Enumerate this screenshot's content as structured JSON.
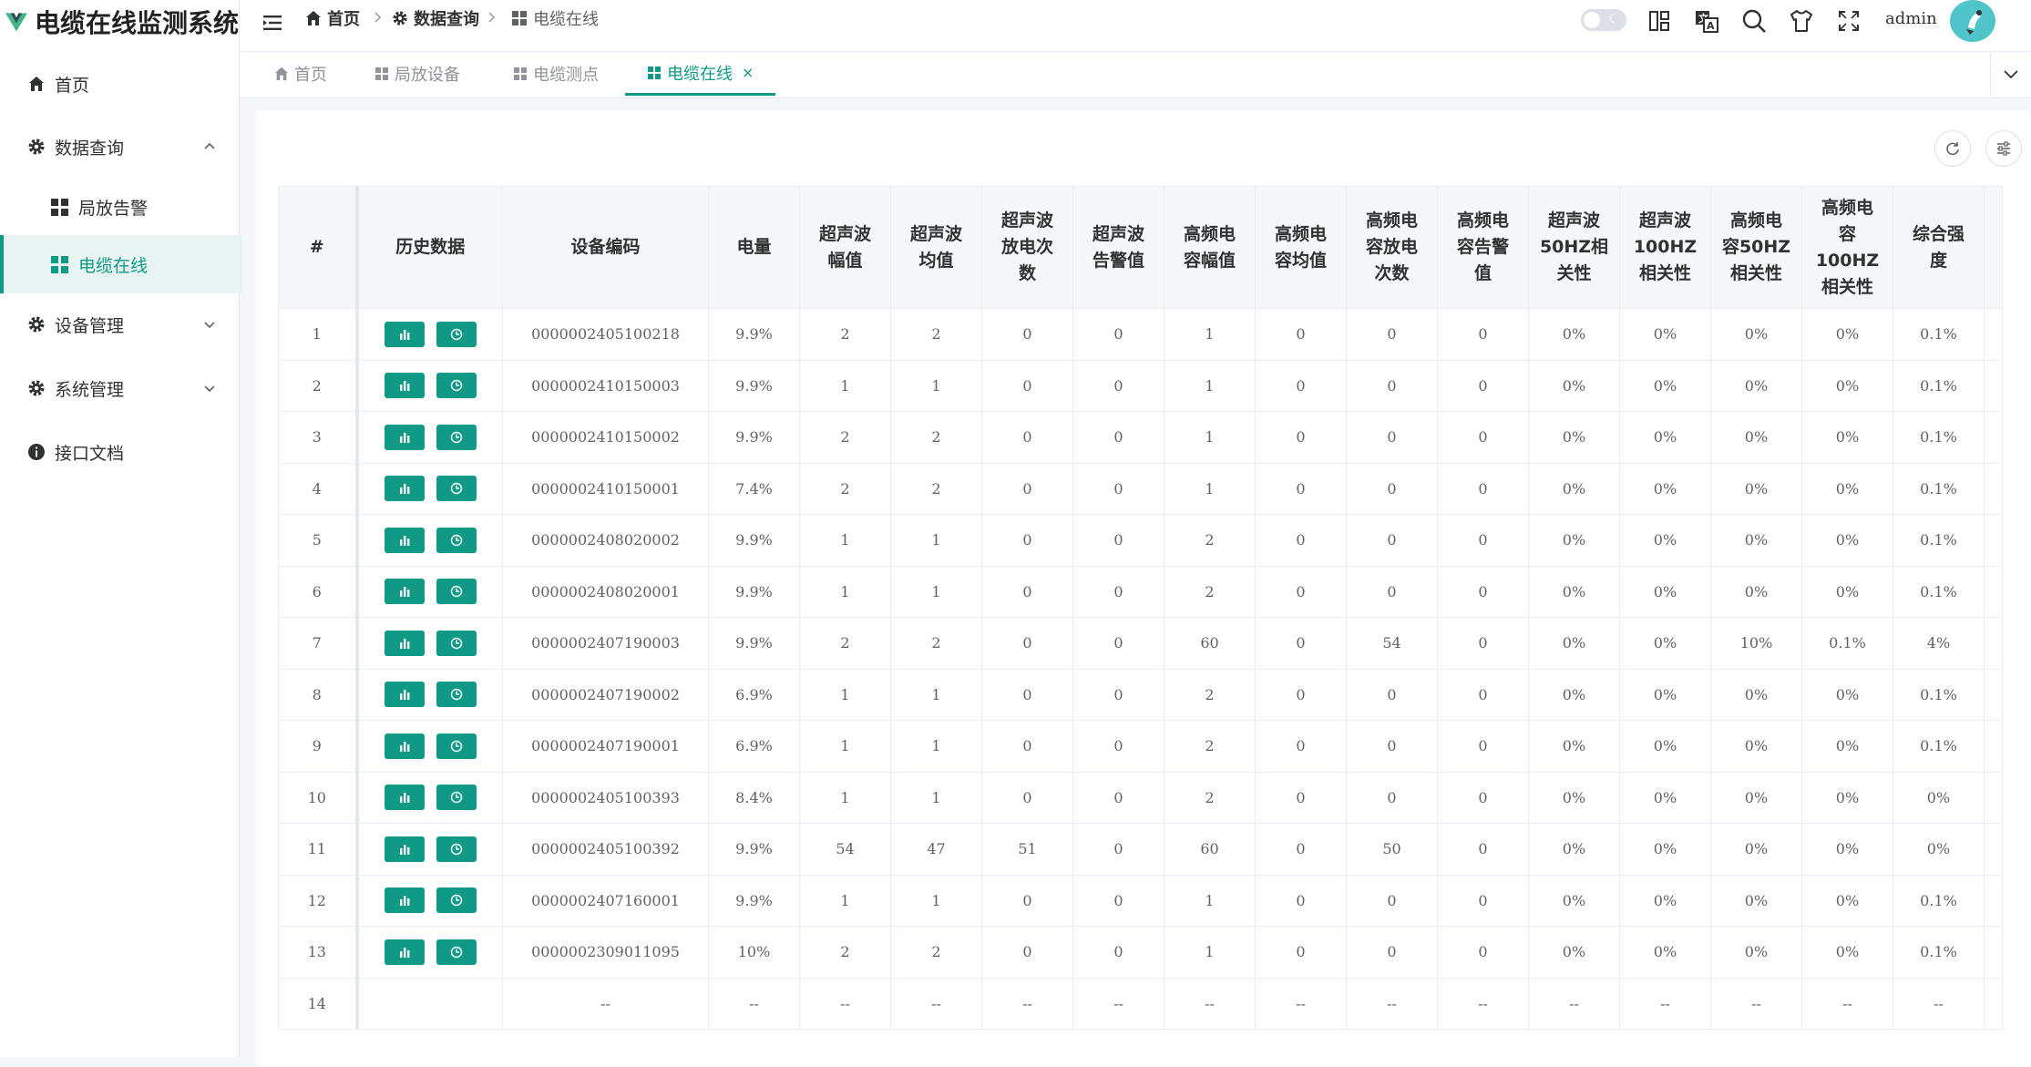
{
  "app": {
    "title": "电缆在线监测系统",
    "logo_icon": "vue-logo-icon",
    "accent": "#0f9a85"
  },
  "sidebar": {
    "items": [
      {
        "label": "首页",
        "icon": "home-icon"
      },
      {
        "label": "数据查询",
        "icon": "gear-icon",
        "expanded": true,
        "children": [
          {
            "label": "局放告警",
            "icon": "grid-icon"
          },
          {
            "label": "电缆在线",
            "icon": "grid-icon",
            "active": true
          }
        ]
      },
      {
        "label": "设备管理",
        "icon": "gear-icon",
        "expanded": false
      },
      {
        "label": "系统管理",
        "icon": "gear-icon",
        "expanded": false
      },
      {
        "label": "接口文档",
        "icon": "info-icon"
      }
    ]
  },
  "header": {
    "breadcrumb": [
      {
        "label": "首页",
        "icon": "home-icon"
      },
      {
        "label": "数据查询",
        "icon": "gear-icon"
      },
      {
        "label": "电缆在线",
        "icon": "grid-icon"
      }
    ],
    "user": "admin",
    "icons": [
      "theme-toggle",
      "layout-icon",
      "translate-icon",
      "search-icon",
      "shirt-icon",
      "fullscreen-icon",
      "avatar"
    ]
  },
  "tabs": [
    {
      "label": "首页",
      "icon": "home-icon"
    },
    {
      "label": "局放设备",
      "icon": "grid-icon"
    },
    {
      "label": "电缆测点",
      "icon": "grid-icon"
    },
    {
      "label": "电缆在线",
      "icon": "grid-icon",
      "active": true,
      "closable": true
    }
  ],
  "table": {
    "columns": [
      "#",
      "历史数据",
      "设备编码",
      "电量",
      "超声波幅值",
      "超声波均值",
      "超声波放电次数",
      "超声波告警值",
      "高频电容幅值",
      "高频电容均值",
      "高频电容放电次数",
      "高频电容告警值",
      "超声波50HZ相关性",
      "超声波100HZ相关性",
      "高频电容50HZ相关性",
      "高频电容100HZ相关性",
      "综合强度"
    ],
    "header_lines": [
      [
        "#"
      ],
      [
        "历史数据"
      ],
      [
        "设备编码"
      ],
      [
        "电量"
      ],
      [
        "超声波",
        "幅值"
      ],
      [
        "超声波",
        "均值"
      ],
      [
        "超声波",
        "放电次",
        "数"
      ],
      [
        "超声波",
        "告警值"
      ],
      [
        "高频电",
        "容幅值"
      ],
      [
        "高频电",
        "容均值"
      ],
      [
        "高频电",
        "容放电",
        "次数"
      ],
      [
        "高频电",
        "容告警",
        "值"
      ],
      [
        "超声波",
        "50HZ相",
        "关性"
      ],
      [
        "超声波",
        "100HZ",
        "相关性"
      ],
      [
        "高频电",
        "容50HZ",
        "相关性"
      ],
      [
        "高频电",
        "容",
        "100HZ",
        "相关性"
      ],
      [
        "综合强",
        "度"
      ]
    ],
    "rows": [
      [
        "1",
        "0000002405100218",
        "9.9%",
        "2",
        "2",
        "0",
        "0",
        "1",
        "0",
        "0",
        "0",
        "0%",
        "0%",
        "0%",
        "0%",
        "0.1%"
      ],
      [
        "2",
        "0000002410150003",
        "9.9%",
        "1",
        "1",
        "0",
        "0",
        "1",
        "0",
        "0",
        "0",
        "0%",
        "0%",
        "0%",
        "0%",
        "0.1%"
      ],
      [
        "3",
        "0000002410150002",
        "9.9%",
        "2",
        "2",
        "0",
        "0",
        "1",
        "0",
        "0",
        "0",
        "0%",
        "0%",
        "0%",
        "0%",
        "0.1%"
      ],
      [
        "4",
        "0000002410150001",
        "7.4%",
        "2",
        "2",
        "0",
        "0",
        "1",
        "0",
        "0",
        "0",
        "0%",
        "0%",
        "0%",
        "0%",
        "0.1%"
      ],
      [
        "5",
        "0000002408020002",
        "9.9%",
        "1",
        "1",
        "0",
        "0",
        "2",
        "0",
        "0",
        "0",
        "0%",
        "0%",
        "0%",
        "0%",
        "0.1%"
      ],
      [
        "6",
        "0000002408020001",
        "9.9%",
        "1",
        "1",
        "0",
        "0",
        "2",
        "0",
        "0",
        "0",
        "0%",
        "0%",
        "0%",
        "0%",
        "0.1%"
      ],
      [
        "7",
        "0000002407190003",
        "9.9%",
        "2",
        "2",
        "0",
        "0",
        "60",
        "0",
        "54",
        "0",
        "0%",
        "0%",
        "10%",
        "0.1%",
        "4%"
      ],
      [
        "8",
        "0000002407190002",
        "6.9%",
        "1",
        "1",
        "0",
        "0",
        "2",
        "0",
        "0",
        "0",
        "0%",
        "0%",
        "0%",
        "0%",
        "0.1%"
      ],
      [
        "9",
        "0000002407190001",
        "6.9%",
        "1",
        "1",
        "0",
        "0",
        "2",
        "0",
        "0",
        "0",
        "0%",
        "0%",
        "0%",
        "0%",
        "0.1%"
      ],
      [
        "10",
        "0000002405100393",
        "8.4%",
        "1",
        "1",
        "0",
        "0",
        "2",
        "0",
        "0",
        "0",
        "0%",
        "0%",
        "0%",
        "0%",
        "0%"
      ],
      [
        "11",
        "0000002405100392",
        "9.9%",
        "54",
        "47",
        "51",
        "0",
        "60",
        "0",
        "50",
        "0",
        "0%",
        "0%",
        "0%",
        "0%",
        "0%"
      ],
      [
        "12",
        "0000002407160001",
        "9.9%",
        "1",
        "1",
        "0",
        "0",
        "1",
        "0",
        "0",
        "0",
        "0%",
        "0%",
        "0%",
        "0%",
        "0.1%"
      ],
      [
        "13",
        "0000002309011095",
        "10%",
        "2",
        "2",
        "0",
        "0",
        "1",
        "0",
        "0",
        "0",
        "0%",
        "0%",
        "0%",
        "0%",
        "0.1%"
      ],
      [
        "14",
        "--",
        "--",
        "--",
        "--",
        "--",
        "--",
        "--",
        "--",
        "--",
        "--",
        "--",
        "--",
        "--",
        "--",
        "--"
      ]
    ],
    "row_actions": [
      {
        "name": "chart-button",
        "icon": "bar-chart-icon"
      },
      {
        "name": "history-button",
        "icon": "clock-icon"
      }
    ],
    "toolbar_icons": [
      "refresh-icon",
      "column-settings-icon"
    ]
  }
}
